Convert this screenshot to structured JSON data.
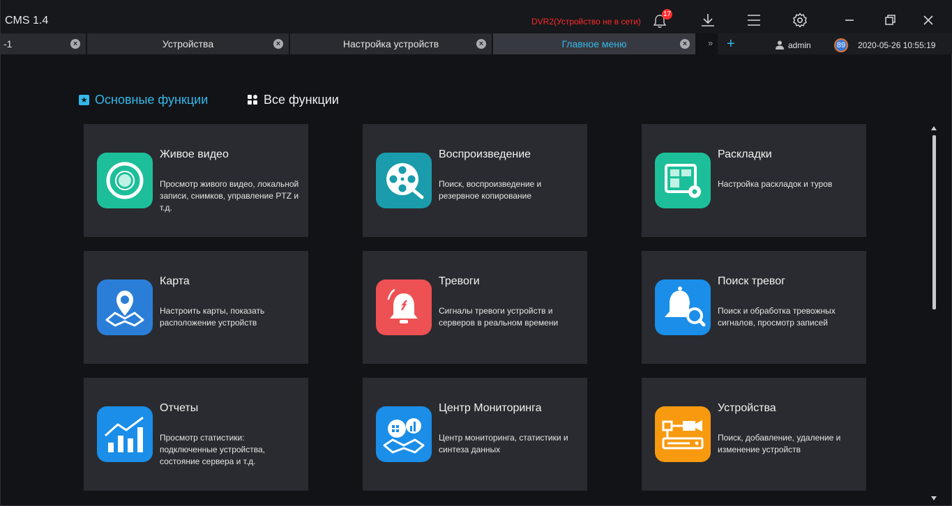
{
  "app": {
    "title": "CMS 1.4",
    "offline_notice": "DVR2(Устройство не в сети)",
    "notification_count": "17",
    "accent_color": "#35b8ea",
    "alert_color": "#ff2a2a"
  },
  "tabs": [
    {
      "label": "-1"
    },
    {
      "label": "Устройства"
    },
    {
      "label": "Настройка устройств"
    },
    {
      "label": "Главное меню"
    }
  ],
  "tabbar": {
    "more": "»",
    "add": "+",
    "user": "admin",
    "cpu": "89",
    "datetime": "2020-05-26 10:55:19"
  },
  "sections": {
    "main": "Основные функции",
    "all": "Все функции"
  },
  "cards": [
    {
      "title": "Живое видео",
      "desc": "Просмотр живого видео, локальной записи, снимков, управление PTZ и т.д.",
      "icon": "live-video-icon",
      "color": "#1dbf9a"
    },
    {
      "title": "Воспроизведение",
      "desc": "Поиск, воспроизведение и резервное копирование",
      "icon": "film-reel-icon",
      "color": "#1a9cac"
    },
    {
      "title": "Раскладки",
      "desc": "Настройка раскладок и туров",
      "icon": "layout-settings-icon",
      "color": "#1dbf9a"
    },
    {
      "title": "Карта",
      "desc": "Настроить карты, показать расположение устройств",
      "icon": "map-pin-icon",
      "color": "#2a7ed8"
    },
    {
      "title": "Тревоги",
      "desc": "Сигналы тревоги устройств и серверов в реальном времени",
      "icon": "alarm-bell-icon",
      "color": "#ee5153"
    },
    {
      "title": "Поиск тревог",
      "desc": "Поиск и обработка тревожных сигналов, просмотр записей",
      "icon": "alarm-search-icon",
      "color": "#1a8ee8"
    },
    {
      "title": "Отчеты",
      "desc": "Просмотр статистики: подключенные устройства, состояние сервера и т.д.",
      "icon": "statistics-chart-icon",
      "color": "#1a8ee8"
    },
    {
      "title": "Центр Мониторинга",
      "desc": "Центр мониторинга, статистики и синтеза данных",
      "icon": "monitoring-center-icon",
      "color": "#1a8ee8"
    },
    {
      "title": "Устройства",
      "desc": "Поиск, добавление, удаление и изменение устройств",
      "icon": "devices-icon",
      "color": "#f79a10"
    }
  ]
}
